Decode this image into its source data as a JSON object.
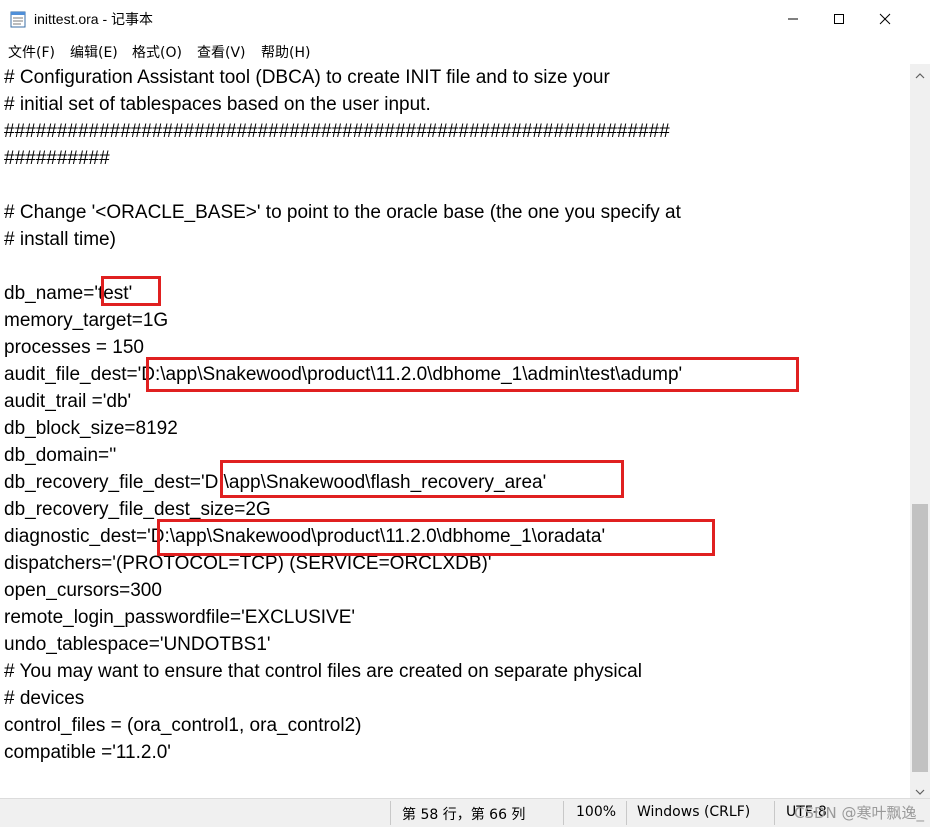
{
  "window": {
    "title": "inittest.ora - 记事本",
    "icons": {
      "app": "notepad-icon",
      "minimize": "minimize-icon",
      "maximize": "maximize-icon",
      "close": "close-icon"
    }
  },
  "menu": [
    {
      "label": "文件(F)"
    },
    {
      "label": "编辑(E)"
    },
    {
      "label": "格式(O)"
    },
    {
      "label": "查看(V)"
    },
    {
      "label": "帮助(H)"
    }
  ],
  "editor": {
    "lines": [
      "# Configuration Assistant tool (DBCA) to create INIT file and to size your",
      "# initial set of tablespaces based on the user input.",
      "###############################################################",
      "##########",
      "",
      "# Change '<ORACLE_BASE>' to point to the oracle base (the one you specify at",
      "# install time)",
      "",
      "db_name='test'",
      "memory_target=1G",
      "processes = 150",
      "audit_file_dest='D:\\app\\Snakewood\\product\\11.2.0\\dbhome_1\\admin\\test\\adump'",
      "audit_trail ='db'",
      "db_block_size=8192",
      "db_domain=''",
      "db_recovery_file_dest='D:\\app\\Snakewood\\flash_recovery_area'",
      "db_recovery_file_dest_size=2G",
      "diagnostic_dest='D:\\app\\Snakewood\\product\\11.2.0\\dbhome_1\\oradata'",
      "dispatchers='(PROTOCOL=TCP) (SERVICE=ORCLXDB)'",
      "open_cursors=300",
      "remote_login_passwordfile='EXCLUSIVE'",
      "undo_tablespace='UNDOTBS1'",
      "# You may want to ensure that control files are created on separate physical",
      "# devices",
      "control_files = (ora_control1, ora_control2)",
      "compatible ='11.2.0'"
    ],
    "highlight_color": "#e02020"
  },
  "status": {
    "position": "第 58 行，第 66 列",
    "zoom": "100%",
    "line_ending": "Windows (CRLF)",
    "encoding": "UTF-8",
    "watermark": "CSDN @寒叶飘逸_"
  }
}
